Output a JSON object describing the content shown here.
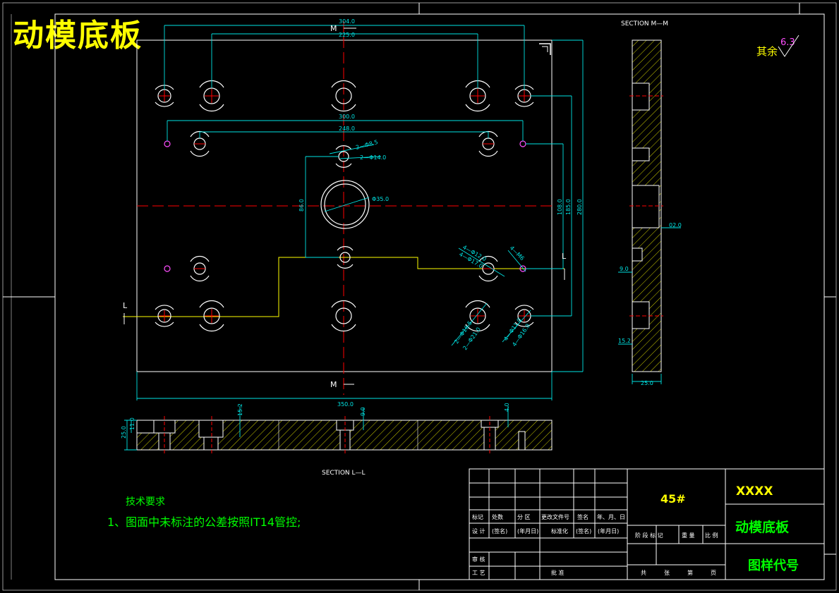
{
  "drawing_title": "动模底板",
  "section_mm_label": "SECTION  M—M",
  "section_ll_label": "SECTION  L—L",
  "roughness": {
    "prefix": "其余",
    "value": "6.3"
  },
  "cut_labels": {
    "m_top": "M",
    "m_bottom": "M",
    "l_left": "L",
    "l_right": "L"
  },
  "dimensions": {
    "top_outer": "304.0",
    "top_inner": "225.0",
    "row2_outer": "300.0",
    "row2_inner": "248.0",
    "hole_small_1": "2—Φ8.5",
    "hole_small_2": "2—Φ14.0",
    "center_bore": "Φ35.0",
    "vertical_center": "86.0",
    "right_v1": "108.0",
    "right_v2": "185.0",
    "right_v3": "280.0",
    "bottom_width": "350.0",
    "mid_right_a": "4—Φ12.0",
    "mid_right_b": "4—Φ17.0",
    "mid_right_c": "4—M6",
    "low_a": "2—Φ16.5",
    "low_b": "2—Φ21.0",
    "low_c": "4—Φ11.0",
    "low_d": "4—Φ16.0",
    "section_depth": "02.0",
    "section_9": "9.0",
    "section_152": "15.2",
    "section_thick": "25.0",
    "ll_left_25": "25.0",
    "ll_left_11": "11.0",
    "ll_152": "15.2",
    "ll_90": "9.0",
    "ll_40": "4.0"
  },
  "tech": {
    "heading": "技术要求",
    "line1": "1、图面中未标注的公差按照IT14管控;"
  },
  "titleblock": {
    "material": "45#",
    "company": "XXXX",
    "part_name": "动模底板",
    "drawing_no": "图样代号",
    "row_labels": [
      "标记",
      "处数",
      "分 区",
      "更改文件号",
      "签名",
      "年、月、日"
    ],
    "row2_labels": [
      "设 计",
      "(签名)",
      "(年月日)",
      "标准化",
      "(签名)",
      "(年月日)"
    ],
    "stage_labels": [
      "阶 段 标 记",
      "重 量",
      "比 例"
    ],
    "review": "审 核",
    "craft": "工 艺",
    "approve": "批 准",
    "sheets": [
      "共",
      "张",
      "第",
      "页"
    ]
  }
}
